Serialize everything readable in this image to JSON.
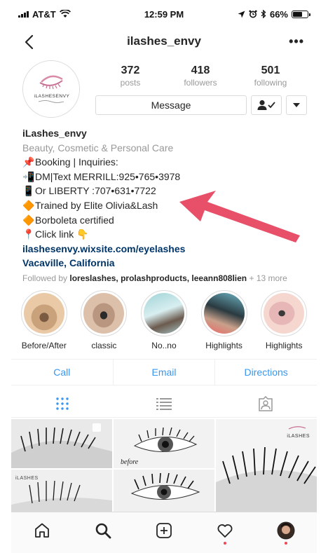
{
  "status_bar": {
    "carrier": "AT&T",
    "time": "12:59 PM",
    "battery": "66%",
    "battery_level": 0.66
  },
  "nav": {
    "title": "ilashes_envy",
    "more": "•••"
  },
  "profile": {
    "avatar_text": "iLASHESENVY",
    "stats": [
      {
        "num": "372",
        "label": "posts"
      },
      {
        "num": "418",
        "label": "followers"
      },
      {
        "num": "501",
        "label": "following"
      }
    ],
    "message_label": "Message"
  },
  "bio": {
    "name": "iLashes_envy",
    "category": "Beauty, Cosmetic & Personal Care",
    "lines": [
      "Booking | Inquiries:",
      "DM|Text MERRILL:925•765•3978",
      "Or LIBERTY :707•631•7722",
      "Trained by Elite Olivia&Lash",
      "Borboleta certified",
      "Click link"
    ],
    "link": "ilashesenvy.wixsite.com/eyelashes",
    "location": "Vacaville, California",
    "followed_prefix": "Followed by",
    "followed_users": "loreslashes, prolashproducts, leeann808lien",
    "followed_more": "+ 13 more"
  },
  "highlights": [
    {
      "label": "Before/After"
    },
    {
      "label": "classic"
    },
    {
      "label": "No..no"
    },
    {
      "label": "Highlights"
    },
    {
      "label": "Highlights"
    }
  ],
  "actions": [
    "Call",
    "Email",
    "Directions"
  ],
  "grid": {
    "overlay_before": "before",
    "overlay_brand": "iLASHES"
  },
  "colors": {
    "accent_blue": "#3897f0",
    "link_blue": "#003569",
    "annotation_arrow": "#e8506a",
    "notification_red": "#ed4956"
  }
}
